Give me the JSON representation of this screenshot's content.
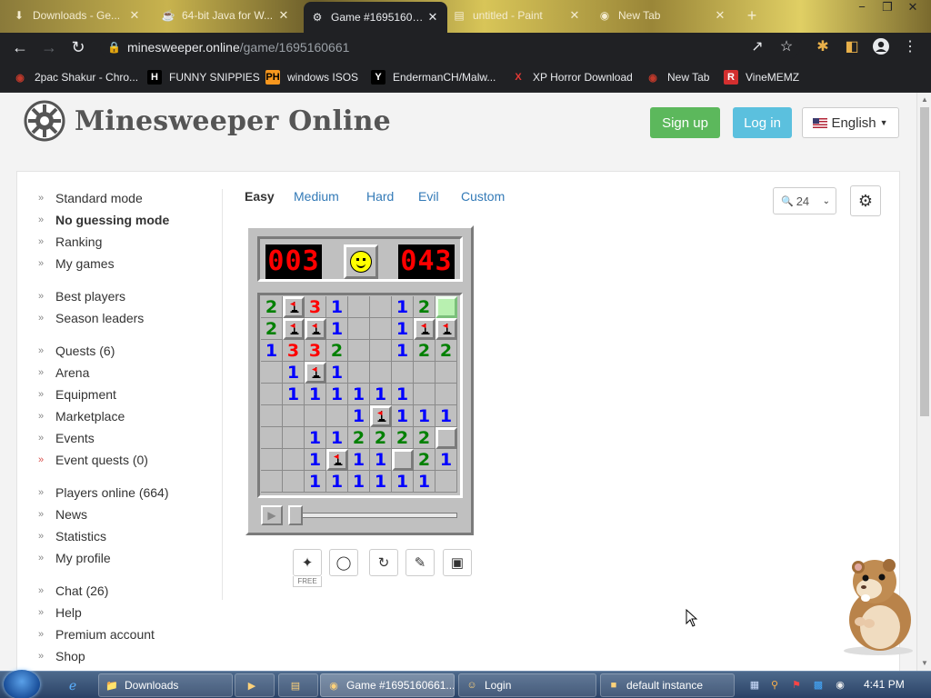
{
  "browser": {
    "tabs": [
      {
        "title": "Downloads - Ge...",
        "icon": "download-icon",
        "active": false
      },
      {
        "title": "64-bit Java for W...",
        "icon": "java-icon",
        "active": false
      },
      {
        "title": "Game #16951606...",
        "icon": "minesweeper-icon",
        "active": true
      },
      {
        "title": "untitled - Paint",
        "icon": "paint-icon",
        "active": false
      },
      {
        "title": "New Tab",
        "icon": "newtab-icon",
        "active": false
      }
    ],
    "new_tab_label": "+",
    "url_host": "minesweeper.online",
    "url_path": "/game/1695160661",
    "bookmarks": [
      {
        "label": "2pac Shakur - Chro...",
        "icon": "chrome-bookmark-icon"
      },
      {
        "label": "FUNNY SNIPPIES",
        "icon": "h-icon"
      },
      {
        "label": "windows ISOS",
        "icon": "ph-icon"
      },
      {
        "label": "EndermanCH/Malw...",
        "icon": "y-icon"
      },
      {
        "label": "XP Horror Download",
        "icon": "x-icon"
      },
      {
        "label": "New Tab",
        "icon": "chrome-bookmark-icon"
      },
      {
        "label": "VineMEMZ",
        "icon": "r-icon"
      }
    ]
  },
  "site": {
    "title": "Minesweeper Online",
    "signup": "Sign up",
    "login": "Log in",
    "language": "English"
  },
  "sidebar": [
    {
      "label": "Standard mode",
      "bold": false
    },
    {
      "label": "No guessing mode",
      "bold": true
    },
    {
      "label": "Ranking"
    },
    {
      "label": "My games"
    },
    {
      "label": "Best players"
    },
    {
      "label": "Season leaders"
    },
    {
      "label": "Quests (6)"
    },
    {
      "label": "Arena"
    },
    {
      "label": "Equipment"
    },
    {
      "label": "Marketplace"
    },
    {
      "label": "Events"
    },
    {
      "label": "Event quests (0)",
      "red": true
    },
    {
      "label": "Players online (664)"
    },
    {
      "label": "News"
    },
    {
      "label": "Statistics"
    },
    {
      "label": "My profile"
    },
    {
      "label": "Chat (26)"
    },
    {
      "label": "Help"
    },
    {
      "label": "Premium account"
    },
    {
      "label": "Shop"
    }
  ],
  "levels": [
    "Easy",
    "Medium",
    "Hard",
    "Evil",
    "Custom"
  ],
  "active_level": "Easy",
  "zoom": "24",
  "game": {
    "mines_left": "003",
    "timer": "043",
    "face": "smile",
    "board": [
      [
        "2",
        "F",
        "3",
        "1",
        "0",
        "0",
        "1",
        "2",
        "H"
      ],
      [
        "2",
        "F",
        "F",
        "1",
        "0",
        "0",
        "1",
        "F",
        "F"
      ],
      [
        "1",
        "3",
        "3",
        "2",
        "0",
        "0",
        "1",
        "2",
        "2"
      ],
      [
        "0",
        "1",
        "F",
        "1",
        "0",
        "0",
        "0",
        "0",
        "0"
      ],
      [
        "0",
        "1",
        "1",
        "1",
        "1",
        "1",
        "1",
        "0",
        "0"
      ],
      [
        "0",
        "0",
        "0",
        "0",
        "1",
        "F",
        "1",
        "1",
        "1"
      ],
      [
        "0",
        "0",
        "1",
        "1",
        "2",
        "2",
        "2",
        "2",
        "C"
      ],
      [
        "0",
        "0",
        "1",
        "F",
        "1",
        "1",
        "C",
        "2",
        "1"
      ],
      [
        "0",
        "0",
        "1",
        "1",
        "1",
        "1",
        "1",
        "1",
        "0"
      ]
    ],
    "tools_free_label": "FREE"
  },
  "taskbar": {
    "items": [
      {
        "label": "Downloads",
        "icon": "folder-icon"
      },
      {
        "label": "",
        "icon": "media-player-icon"
      },
      {
        "label": "",
        "icon": "paint-icon"
      },
      {
        "label": "Game #1695160661...",
        "icon": "chrome-icon",
        "active": true
      },
      {
        "label": "Login",
        "icon": "login-icon"
      },
      {
        "label": "default instance",
        "icon": "minecraft-icon"
      }
    ],
    "clock": "4:41 PM"
  },
  "colors": {
    "signup": "#5cb85c",
    "login": "#5bc0de",
    "link": "#337ab7",
    "counter_digits": "#ff0000"
  }
}
